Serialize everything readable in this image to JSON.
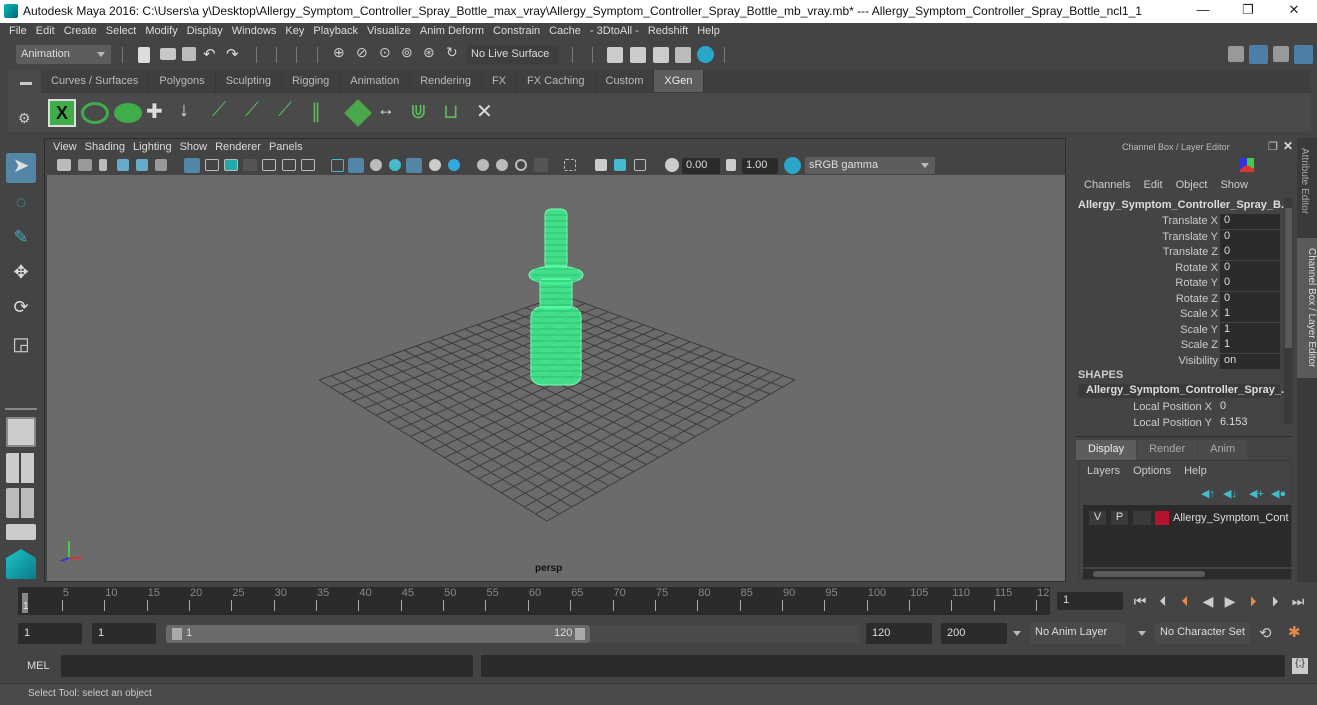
{
  "window": {
    "title": "Autodesk Maya 2016: C:\\Users\\a y\\Desktop\\Allergy_Symptom_Controller_Spray_Bottle_max_vray\\Allergy_Symptom_Controller_Spray_Bottle_mb_vray.mb*  ---  Allergy_Symptom_Controller_Spray_Bottle_ncl1_1",
    "minimize": "—",
    "maximize": "❐",
    "close": "✕"
  },
  "menubar": [
    "File",
    "Edit",
    "Create",
    "Select",
    "Modify",
    "Display",
    "Windows",
    "Key",
    "Playback",
    "Visualize",
    "Anim Deform",
    "Constrain",
    "Cache",
    "- 3DtoAll -",
    "Redshift",
    "Help"
  ],
  "statusline": {
    "menuset": "Animation",
    "live_surface": "No Live Surface"
  },
  "shelf": {
    "tabs": [
      "Curves / Surfaces",
      "Polygons",
      "Sculpting",
      "Rigging",
      "Animation",
      "Rendering",
      "FX",
      "FX Caching",
      "Custom",
      "XGen"
    ],
    "active_tab": "XGen",
    "icons": [
      "xgen-create-description-icon",
      "xgen-toggle-preview-icon",
      "xgen-hide-preview-icon",
      "add-guides-icon",
      "place-guides-icon",
      "add-guide-icon",
      "select-guides-icon",
      "lock-guides-icon",
      "guides-icon",
      "grid-guides-icon",
      "normalize-guides-icon",
      "sculpt-guides-icon",
      "guide-frame-icon",
      "delete-guides-icon"
    ]
  },
  "viewport": {
    "menus": [
      "View",
      "Shading",
      "Lighting",
      "Show",
      "Renderer",
      "Panels"
    ],
    "exposure": "0.00",
    "gamma": "1.00",
    "color_space": "sRGB gamma",
    "camera_label": "persp",
    "model_color": "#3cf28f"
  },
  "channelbox": {
    "title": "Channel Box / Layer Editor",
    "menus": [
      "Channels",
      "Edit",
      "Object",
      "Show"
    ],
    "object_name": "Allergy_Symptom_Controller_Spray_B...",
    "channels": [
      {
        "label": "Translate X",
        "value": "0"
      },
      {
        "label": "Translate Y",
        "value": "0"
      },
      {
        "label": "Translate Z",
        "value": "0"
      },
      {
        "label": "Rotate X",
        "value": "0"
      },
      {
        "label": "Rotate Y",
        "value": "0"
      },
      {
        "label": "Rotate Z",
        "value": "0"
      },
      {
        "label": "Scale X",
        "value": "1"
      },
      {
        "label": "Scale Y",
        "value": "1"
      },
      {
        "label": "Scale Z",
        "value": "1"
      },
      {
        "label": "Visibility",
        "value": "on"
      }
    ],
    "shapes_header": "SHAPES",
    "shape_name": "Allergy_Symptom_Controller_Spray_...",
    "shape_channels": [
      {
        "label": "Local Position X",
        "value": "0"
      },
      {
        "label": "Local Position Y",
        "value": "6.153"
      }
    ]
  },
  "layer_editor": {
    "tabs": [
      "Display",
      "Render",
      "Anim"
    ],
    "active_tab": "Display",
    "menus": [
      "Layers",
      "Options",
      "Help"
    ],
    "layer": {
      "v": "V",
      "p": "P",
      "color": "#b5132b",
      "name": "Allergy_Symptom_Contro"
    }
  },
  "side_tabs": [
    "Attribute Editor",
    "Channel Box / Layer Editor"
  ],
  "timeslider": {
    "ticks": [
      "5",
      "10",
      "15",
      "20",
      "25",
      "30",
      "35",
      "40",
      "45",
      "50",
      "55",
      "60",
      "65",
      "70",
      "75",
      "80",
      "85",
      "90",
      "95",
      "100",
      "105",
      "110",
      "115",
      "12"
    ],
    "current_marker": "1",
    "current_frame": "1"
  },
  "range": {
    "start": "1",
    "playback_start": "1",
    "slider_start": "1",
    "slider_end": "120",
    "playback_end": "120",
    "end": "200",
    "anim_layer": "No Anim Layer",
    "character_set": "No Character Set"
  },
  "cmdline": {
    "label": "MEL"
  },
  "helpline": {
    "text": "Select Tool: select an object"
  }
}
